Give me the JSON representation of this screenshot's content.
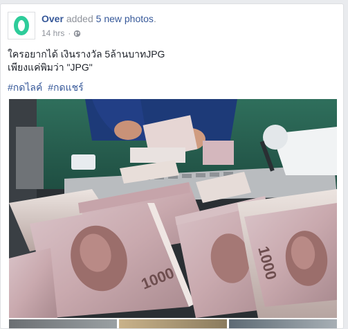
{
  "post": {
    "author": "Over",
    "action": "added",
    "photos_link": "5 new photos",
    "action_suffix": ".",
    "timestamp": "14 hrs",
    "separator": "·",
    "audience_icon": "globe-icon",
    "avatar_letter": "O",
    "avatar_color": "#2ecc9a",
    "message_line_1": "ใครอยากได้ เงินรางวัล 5ล้านบาทJPG",
    "message_line_2": "เพียงแค่พิมว่า \"JPG\"",
    "hashtags": [
      "#กดไลค์",
      "#กดแชร์"
    ],
    "main_photo_icon": "thai-1000-baht-banknotes-photo",
    "thumbnail_count": 3
  },
  "colors": {
    "link": "#365899",
    "meta": "#90949c",
    "text": "#1d2129",
    "background": "#e9ebee"
  }
}
